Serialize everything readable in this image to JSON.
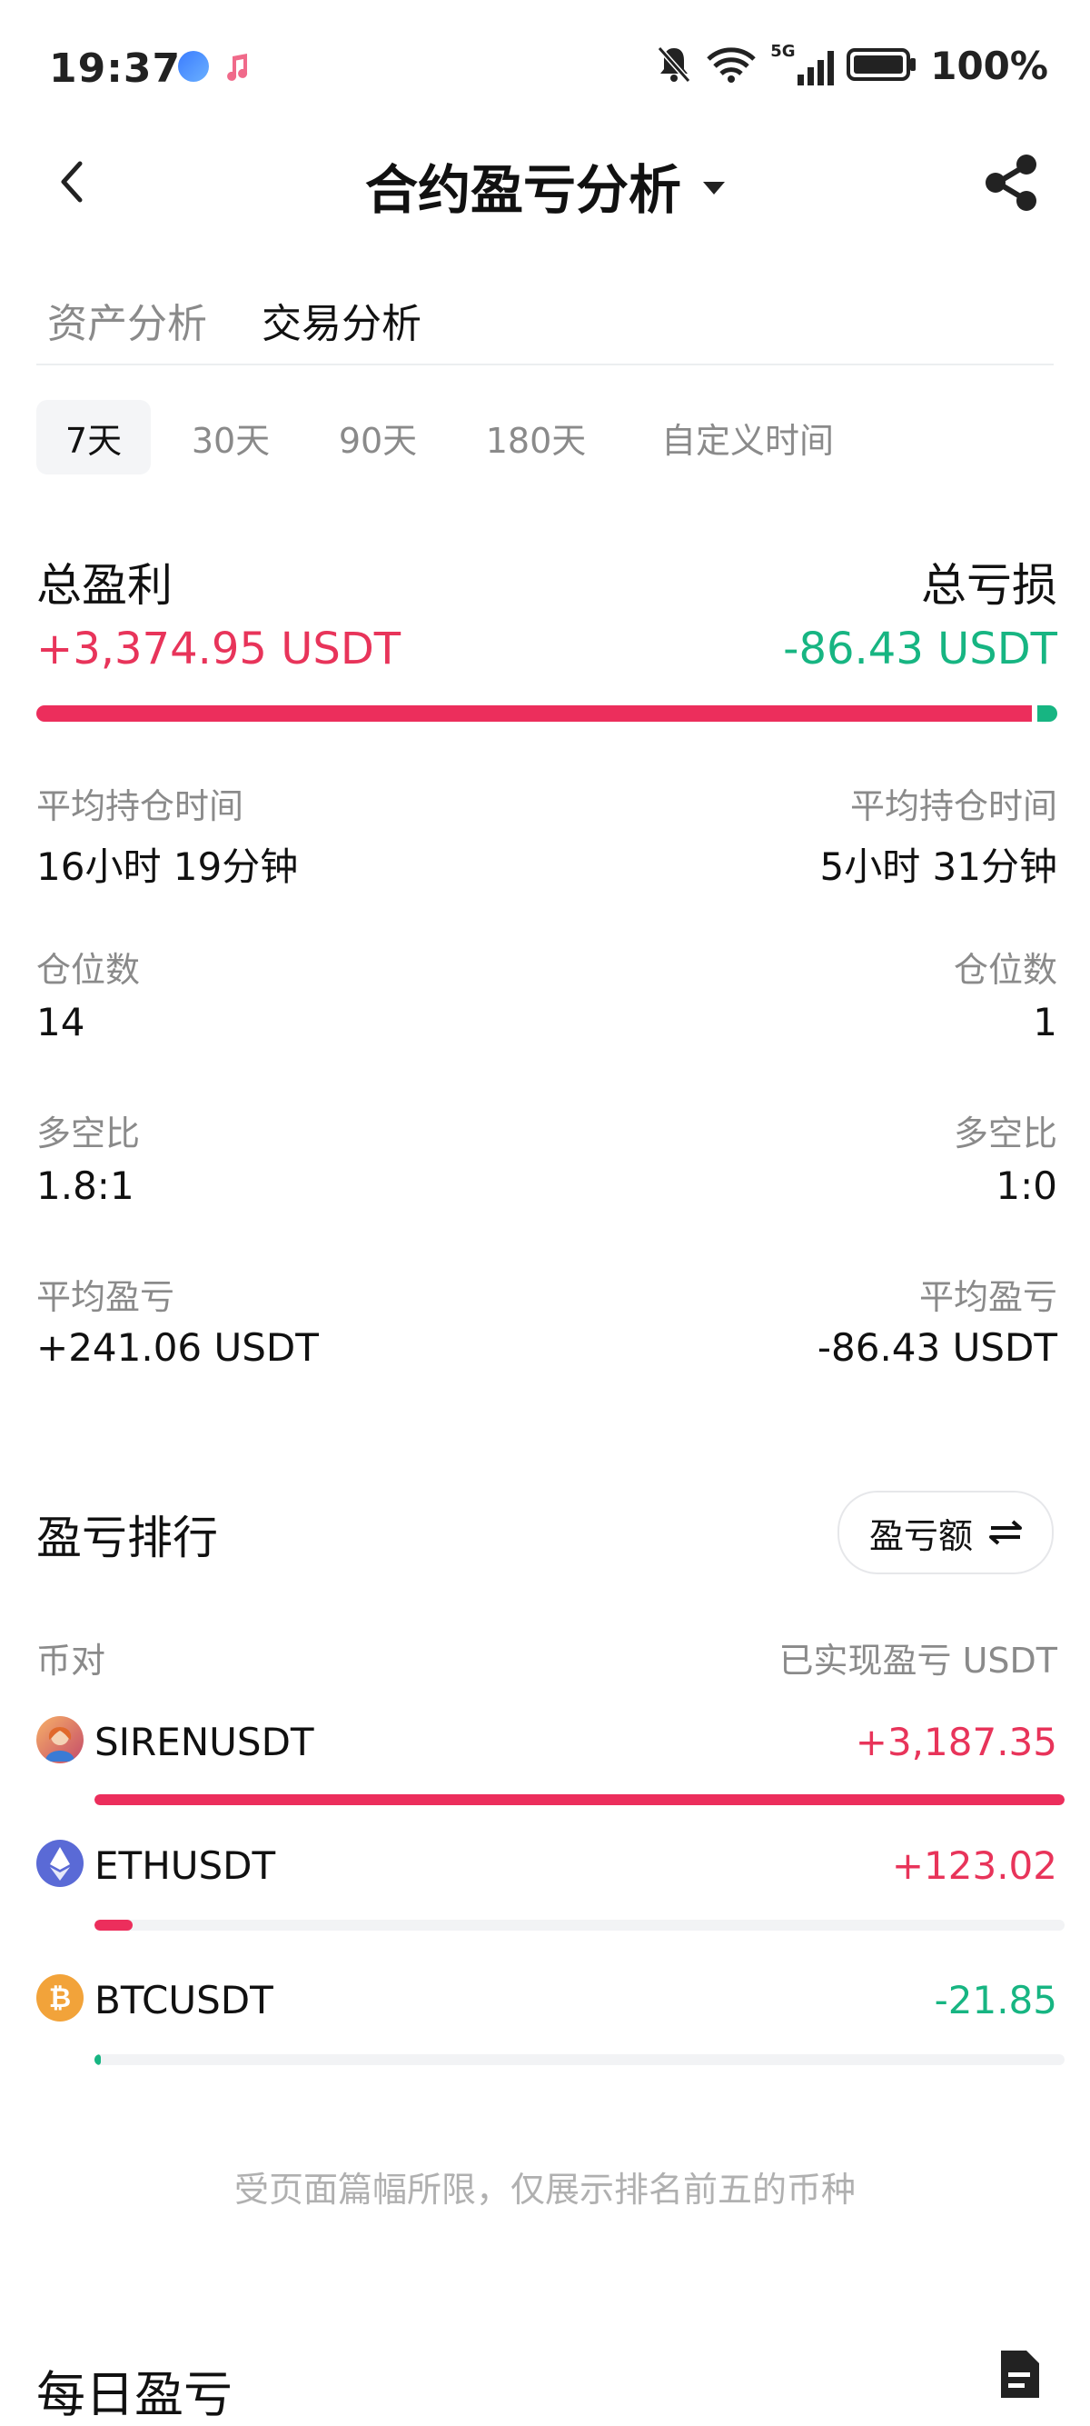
{
  "status": {
    "time": "19:37",
    "battery": "100%",
    "network": "5G"
  },
  "header": {
    "title": "合约盈亏分析"
  },
  "tabs": [
    {
      "label": "资产分析",
      "active": false
    },
    {
      "label": "交易分析",
      "active": true
    }
  ],
  "periods": [
    "7天",
    "30天",
    "90天",
    "180天",
    "自定义时间"
  ],
  "selected_period": "7天",
  "summary": {
    "profit": {
      "label": "总盈利",
      "amount": "+3,374.95 USDT",
      "avg_hold_label": "平均持仓时间",
      "avg_hold": "16小时 19分钟",
      "positions_label": "仓位数",
      "positions": "14",
      "long_short_label": "多空比",
      "long_short": "1.8:1",
      "avg_pnl_label": "平均盈亏",
      "avg_pnl": "+241.06 USDT"
    },
    "loss": {
      "label": "总亏损",
      "amount": "-86.43 USDT",
      "avg_hold_label": "平均持仓时间",
      "avg_hold": "5小时 31分钟",
      "positions_label": "仓位数",
      "positions": "1",
      "long_short_label": "多空比",
      "long_short": "1:0",
      "avg_pnl_label": "平均盈亏",
      "avg_pnl": "-86.43 USDT"
    },
    "profit_ratio": 0.975
  },
  "ranking": {
    "title": "盈亏排行",
    "toggle_label": "盈亏额",
    "col_pair": "币对",
    "col_pnl": "已实现盈亏 USDT",
    "rows": [
      {
        "pair": "SIRENUSDT",
        "pnl": "+3,187.35",
        "fill": 1.0,
        "sign": "pos"
      },
      {
        "pair": "ETHUSDT",
        "pnl": "+123.02",
        "fill": 0.039,
        "sign": "pos"
      },
      {
        "pair": "BTCUSDT",
        "pnl": "-21.85",
        "fill": 0.007,
        "sign": "neg"
      }
    ],
    "note": "受页面篇幅所限，仅展示排名前五的币种"
  },
  "daily": {
    "title": "每日盈亏"
  },
  "colors": {
    "positive": "#e8345a",
    "negative": "#17b582",
    "bar_positive": "#ec2e5c"
  }
}
